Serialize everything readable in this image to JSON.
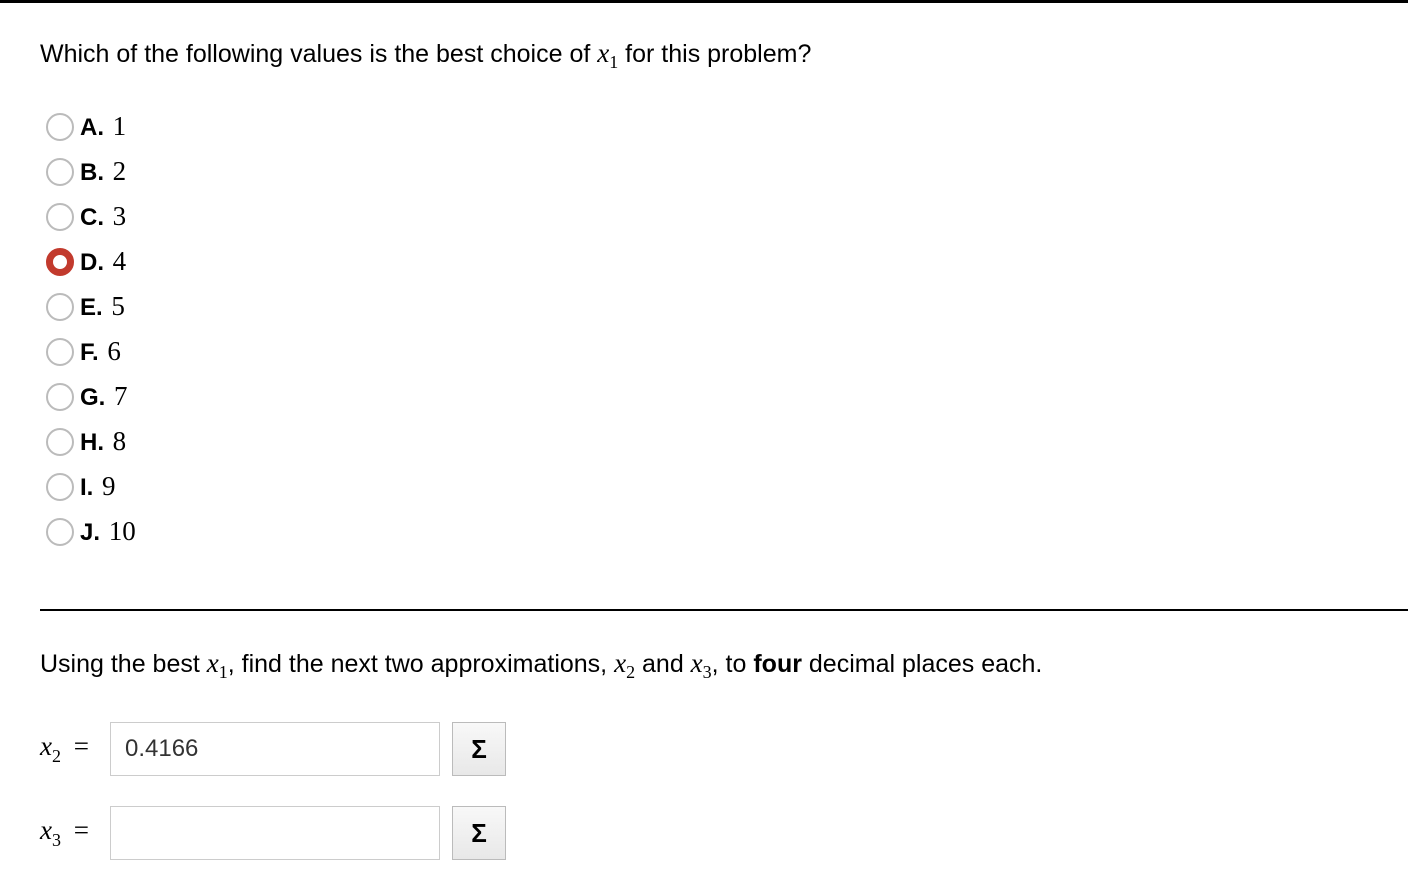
{
  "question1": {
    "prefix": "Which of the following values is the best choice of ",
    "var": "x",
    "sub": "1",
    "suffix": " for this problem?"
  },
  "choices": [
    {
      "letter": "A.",
      "value": "1",
      "selected": false
    },
    {
      "letter": "B.",
      "value": "2",
      "selected": false
    },
    {
      "letter": "C.",
      "value": "3",
      "selected": false
    },
    {
      "letter": "D.",
      "value": "4",
      "selected": true
    },
    {
      "letter": "E.",
      "value": "5",
      "selected": false
    },
    {
      "letter": "F.",
      "value": "6",
      "selected": false
    },
    {
      "letter": "G.",
      "value": "7",
      "selected": false
    },
    {
      "letter": "H.",
      "value": "8",
      "selected": false
    },
    {
      "letter": "I.",
      "value": "9",
      "selected": false
    },
    {
      "letter": "J.",
      "value": "10",
      "selected": false
    }
  ],
  "instruction": {
    "p1": "Using the best ",
    "x1v": "x",
    "x1s": "1",
    "p2": ", find the next two approximations, ",
    "x2v": "x",
    "x2s": "2",
    "p3": " and ",
    "x3v": "x",
    "x3s": "3",
    "p4": ", to ",
    "bold": "four",
    "p5": " decimal places each."
  },
  "answers": {
    "x2": {
      "var": "x",
      "sub": "2",
      "eq": "=",
      "value": "0.4166",
      "sigma": "Σ"
    },
    "x3": {
      "var": "x",
      "sub": "3",
      "eq": "=",
      "value": "",
      "sigma": "Σ"
    }
  }
}
